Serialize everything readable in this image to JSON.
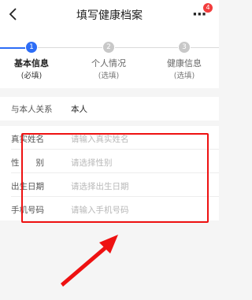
{
  "header": {
    "title": "填写健康档案",
    "back_icon": "chevron-left-icon",
    "more_icon": "more-dots-icon",
    "more_glyph": "···",
    "badge_count": "4"
  },
  "steps": [
    {
      "number": "1",
      "label": "基本信息",
      "sub": "(必填)",
      "active": true
    },
    {
      "number": "2",
      "label": "个人情况",
      "sub": "(选填)",
      "active": false
    },
    {
      "number": "3",
      "label": "健康信息",
      "sub": "(选填)",
      "active": false
    }
  ],
  "relation": {
    "label": "与本人关系",
    "value": "本人"
  },
  "form": {
    "name_label": "真实姓名",
    "name_placeholder": "请输入真实姓名",
    "gender_label": "性　　别",
    "gender_placeholder": "请选择性别",
    "birth_label": "出生日期",
    "birth_placeholder": "请选择出生日期",
    "phone_label": "手机号码",
    "phone_placeholder": "请输入手机号码"
  },
  "colors": {
    "accent": "#2d6df6",
    "annotation": "#ee1111",
    "badge": "#f23c3c"
  }
}
